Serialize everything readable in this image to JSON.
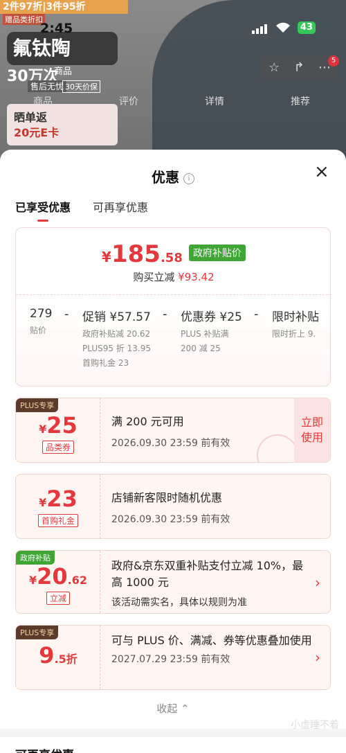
{
  "background": {
    "banner_top": "2件97折|3件95折",
    "promo_tag": "赠品类折扣",
    "brand": "氟钛陶",
    "line2": "30万次",
    "guarantee": "售后无忧",
    "guarantee2": "30天价保",
    "goods_tab": "商品",
    "card_line1": "晒单返",
    "card_line2": "20元E卡",
    "nav_items": [
      "商品",
      "评价",
      "详情",
      "推荐"
    ]
  },
  "status_bar": {
    "time": "2:45",
    "battery": "43"
  },
  "topbar": {
    "badge": "5"
  },
  "sheet": {
    "title": "优惠",
    "info_icon": "i",
    "close_icon": "×",
    "tabs": [
      {
        "label": "已享受优惠",
        "active": true
      },
      {
        "label": "可再享优惠",
        "active": false
      }
    ]
  },
  "summary": {
    "currency": "¥",
    "price_int": "185",
    "price_dec": ".58",
    "gov_tag": "政府补贴价",
    "reduce_label": "购买立减",
    "reduce_amount": "¥93.42",
    "calc": {
      "base_value": "279",
      "base_label": "贴价",
      "op1": "-",
      "promo_title": "促销 ¥57.57",
      "promo_lines": [
        "政府补贴减 20.62",
        "PLUS95 折 13.95",
        "首购礼金 23"
      ],
      "op2": "-",
      "coupon_title": "优惠券 ¥25",
      "coupon_lines": [
        "PLUS 补贴满",
        "200 减 25"
      ],
      "op3": "-",
      "limit_title": "限时补贴",
      "limit_lines": [
        "限时折上 9."
      ]
    }
  },
  "coupons": [
    {
      "badge": "PLUS专享",
      "yen": "¥",
      "amount": "25",
      "label": "品类券",
      "title": "满 200 元可用",
      "date": "2026.09.30 23:59 前有效",
      "action": "立即使用"
    },
    {
      "yen": "¥",
      "amount": "23",
      "label": "首购礼金",
      "title": "店铺新客限时随机优惠",
      "date": "2026.09.30 23:59 前有效"
    },
    {
      "badge": "政府补贴",
      "yen": "¥",
      "amount": "20",
      "amount_dec": ".62",
      "label": "立减",
      "title": "政府&京东双重补贴支付立减 10%，最高 1000 元",
      "note": "该活动需实名，具体以规则为准",
      "chevron": "›"
    },
    {
      "badge": "PLUS专享",
      "amount": "9",
      "amount_dec": ".5折",
      "title": "可与 PLUS 价、满减、券等优惠叠加使用",
      "date": "2027.07.29 23:59 前有效",
      "chevron": "›"
    }
  ],
  "collapse_label": "收起 ⌃",
  "next_section_title": "可再享优惠",
  "watermark": "小虚睡不着"
}
